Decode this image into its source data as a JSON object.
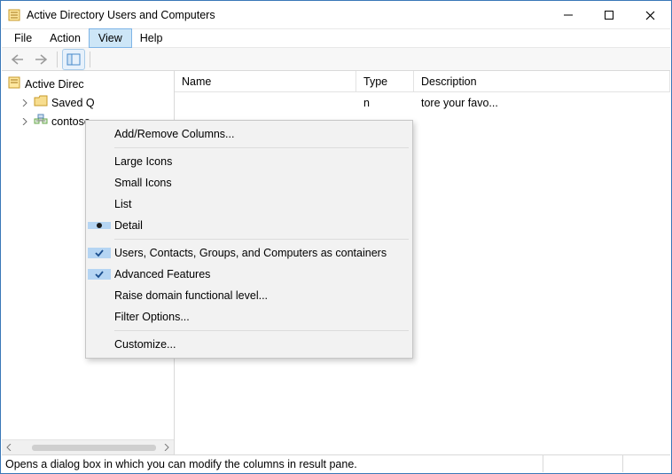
{
  "window": {
    "title": "Active Directory Users and Computers"
  },
  "menubar": {
    "file": "File",
    "action": "Action",
    "view": "View",
    "help": "Help"
  },
  "tree": {
    "root": "Active Direc",
    "savedQueries": "Saved Q",
    "domain": "contoso"
  },
  "columns": {
    "name": "Name",
    "type": "Type",
    "description": "Description"
  },
  "rows": [
    {
      "type": "n",
      "description": "tore your favo..."
    }
  ],
  "viewMenu": {
    "addRemove": "Add/Remove Columns...",
    "largeIcons": "Large Icons",
    "smallIcons": "Small Icons",
    "list": "List",
    "detail": "Detail",
    "usersContacts": "Users, Contacts, Groups, and Computers as containers",
    "advancedFeatures": "Advanced Features",
    "raiseDomain": "Raise domain functional level...",
    "filterOptions": "Filter Options...",
    "customize": "Customize..."
  },
  "status": {
    "text": "Opens a dialog box in which you can modify the columns in result pane."
  }
}
